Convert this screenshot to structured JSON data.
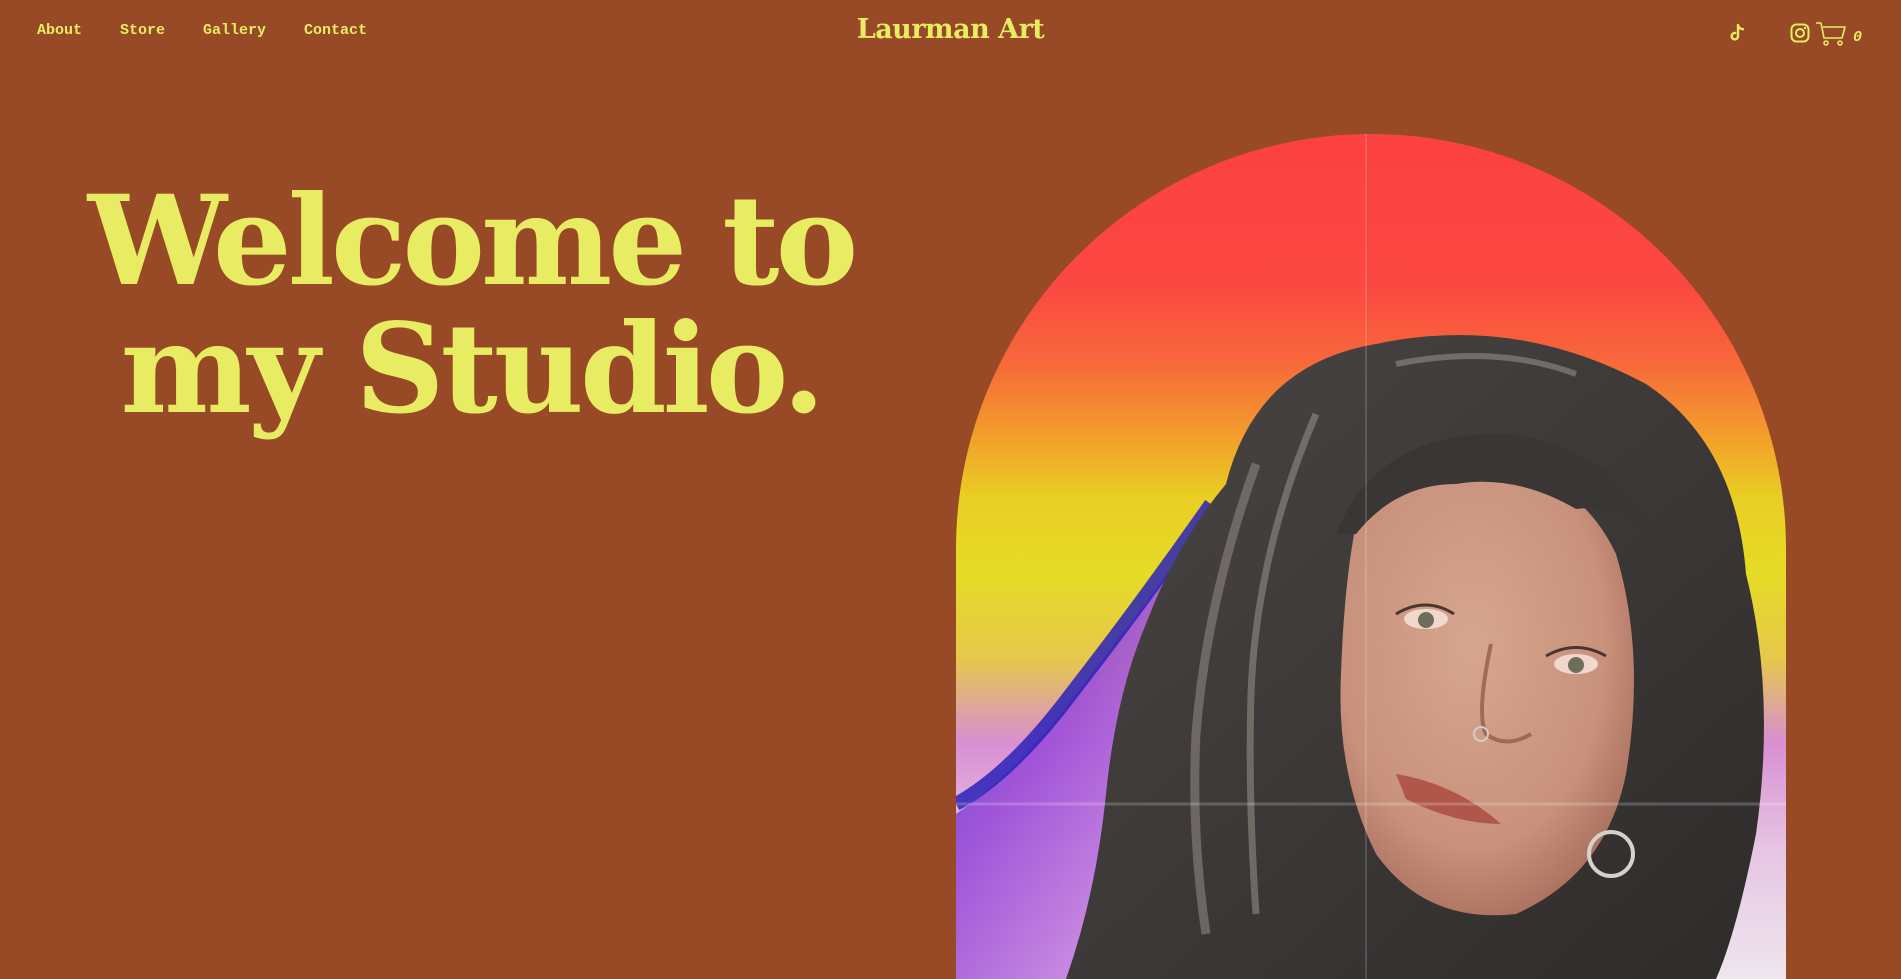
{
  "nav": {
    "items": [
      {
        "label": "About"
      },
      {
        "label": "Store"
      },
      {
        "label": "Gallery"
      },
      {
        "label": "Contact"
      }
    ]
  },
  "brand": {
    "title": "Laurman Art"
  },
  "header": {
    "icons": [
      "tiktok-icon",
      "instagram-icon",
      "cart-icon"
    ],
    "cart_count": "0"
  },
  "hero": {
    "line1": "Welcome to",
    "line2": "my Studio."
  },
  "colors": {
    "background": "#974a25",
    "accent": "#e8ec62",
    "arch_top": "#fb4141",
    "arch_mid": "#e5dc26"
  }
}
